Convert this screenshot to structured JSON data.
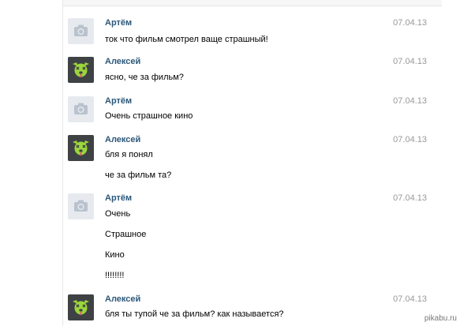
{
  "messages": [
    {
      "author": "Артём",
      "avatar": "camera-icon",
      "date": "07.04.13",
      "lines": [
        "ток что фильм смотрел ваще страшный!"
      ]
    },
    {
      "author": "Алексей",
      "avatar": "dog-avatar",
      "date": "07.04.13",
      "lines": [
        "ясно, че за фильм?"
      ]
    },
    {
      "author": "Артём",
      "avatar": "camera-icon",
      "date": "07.04.13",
      "lines": [
        "Очень страшное кино"
      ]
    },
    {
      "author": "Алексей",
      "avatar": "dog-avatar",
      "date": "07.04.13",
      "lines": [
        "бля я понял",
        "че за фильм та?"
      ]
    },
    {
      "author": "Артём",
      "avatar": "camera-icon",
      "date": "07.04.13",
      "lines": [
        "Очень",
        "Страшное",
        "Кино",
        "!!!!!!!!"
      ]
    },
    {
      "author": "Алексей",
      "avatar": "dog-avatar",
      "date": "07.04.13",
      "lines": [
        "бля ты тупой че за фильм? как называется?"
      ]
    }
  ],
  "watermark": "pikabu.ru",
  "colors": {
    "author": "#2b587a",
    "date": "#999999",
    "dog_green": "#9bd63c",
    "dog_bg": "#3f4245",
    "camera_bg": "#e6eaef"
  }
}
